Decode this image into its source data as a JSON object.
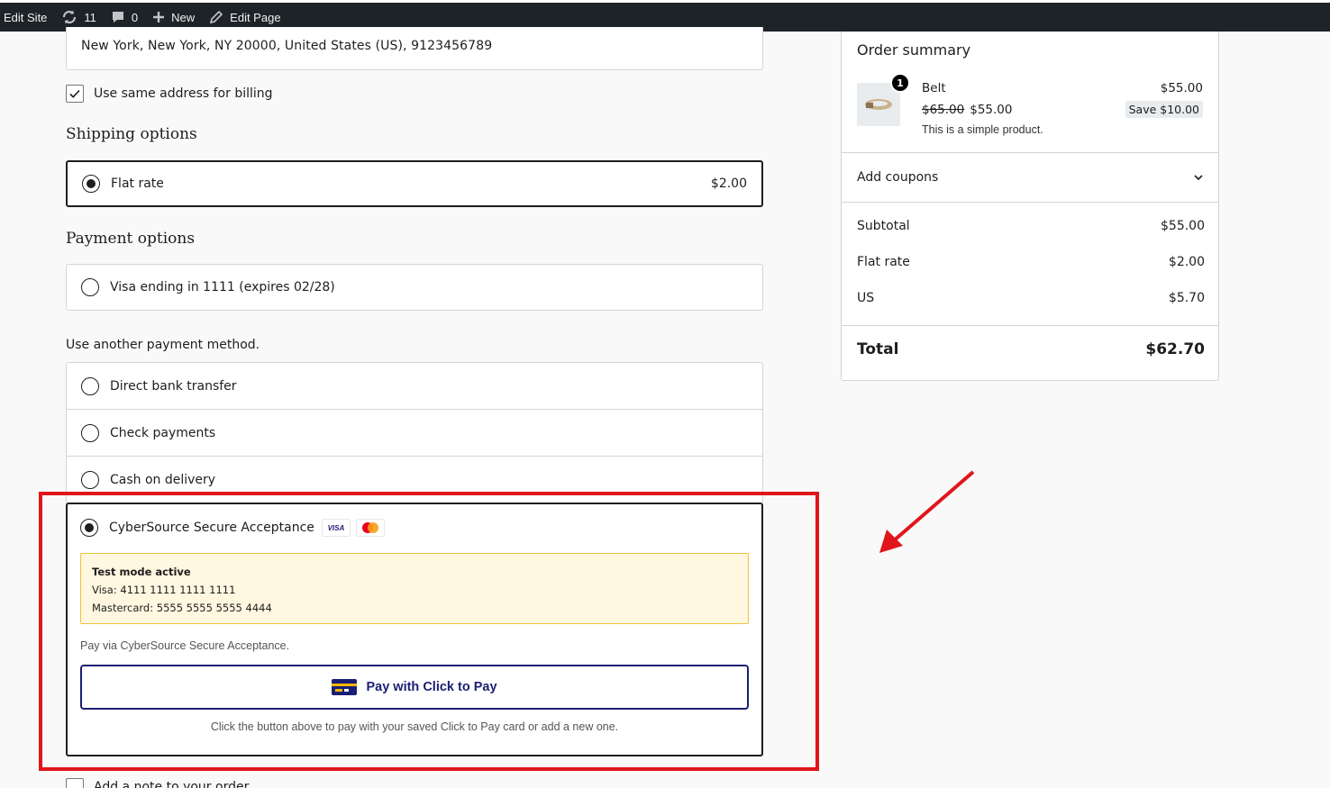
{
  "admin_bar": {
    "edit_site": "Edit Site",
    "updates_count": "11",
    "comments_count": "0",
    "new_label": "New",
    "edit_page": "Edit Page"
  },
  "shipping_address": "New York, New York, NY 20000, United States (US), 9123456789",
  "billing_checkbox": {
    "label": "Use same address for billing",
    "checked": true
  },
  "shipping": {
    "title": "Shipping options",
    "option_label": "Flat rate",
    "option_price": "$2.00"
  },
  "payment": {
    "title": "Payment options",
    "saved_card": "Visa ending in 1111 (expires 02/28)",
    "other_label": "Use another payment method.",
    "methods": [
      "Direct bank transfer",
      "Check payments",
      "Cash on delivery"
    ],
    "cybersource": {
      "label": "CyberSource Secure Acceptance",
      "visa_logo": "VISA",
      "notice_title": "Test mode active",
      "notice_visa": "Visa: 4111 1111 1111 1111",
      "notice_mc": "Mastercard: 5555 5555 5555 4444",
      "description": "Pay via CyberSource Secure Acceptance.",
      "button_label": "Pay with Click to Pay",
      "hint": "Click the button above to pay with your saved Click to Pay card or add a new one."
    }
  },
  "note_checkbox": "Add a note to your order",
  "summary": {
    "title": "Order summary",
    "item": {
      "quantity": "1",
      "name": "Belt",
      "price": "$55.00",
      "old_price": "$65.00",
      "new_price": "$55.00",
      "save": "Save $10.00",
      "description": "This is a simple product."
    },
    "coupons_label": "Add coupons",
    "rows": [
      {
        "label": "Subtotal",
        "value": "$55.00"
      },
      {
        "label": "Flat rate",
        "value": "$2.00"
      },
      {
        "label": "US",
        "value": "$5.70"
      }
    ],
    "total_label": "Total",
    "total_value": "$62.70"
  },
  "colors": {
    "highlight_red": "#e0161c",
    "click_to_pay_navy": "#1a1f71",
    "notice_bg": "#fff7e0",
    "notice_border": "#f0c23b"
  }
}
